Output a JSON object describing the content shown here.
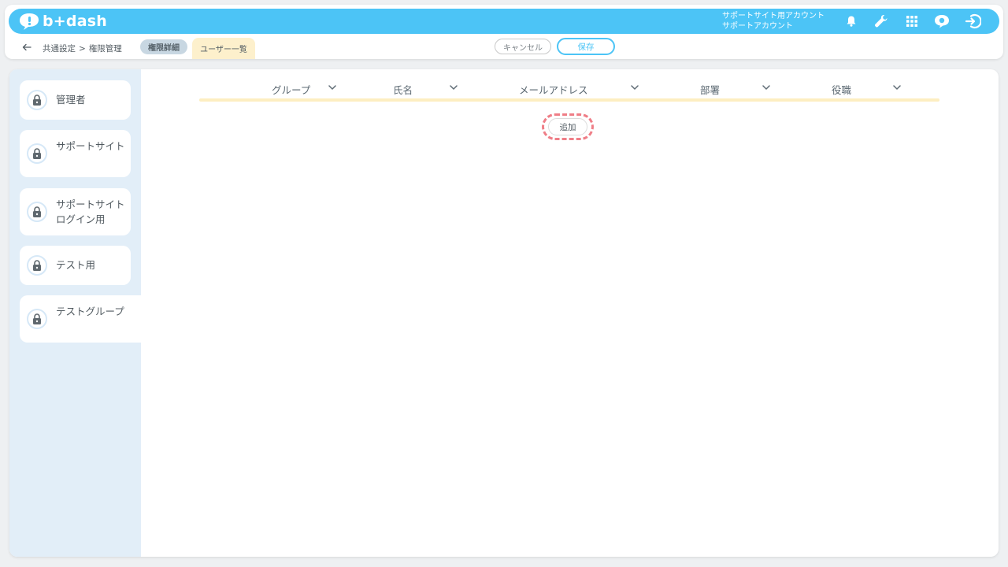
{
  "app": {
    "logo_text": "b+dash",
    "brand_color": "#4cc4f6"
  },
  "account": {
    "line1": "サポートサイト用アカウント",
    "line2": "サポートアカウント"
  },
  "header_icons": [
    "bell-icon",
    "wrench-icon",
    "grid-icon",
    "chat-badge-icon",
    "logout-icon"
  ],
  "breadcrumb": {
    "part1": "共通設定",
    "separator": ">",
    "part2": "権限管理"
  },
  "tabs": {
    "detail": "権限詳細",
    "users": "ユーザー一覧"
  },
  "actions": {
    "cancel": "キャンセル",
    "save": "保存"
  },
  "sidebar": {
    "items": [
      {
        "label": "管理者"
      },
      {
        "label": "サポートサイト"
      },
      {
        "label": "サポートサイトログイン用"
      },
      {
        "label": "テスト用"
      },
      {
        "label": "テストグループ"
      }
    ]
  },
  "table": {
    "columns": [
      "グループ",
      "氏名",
      "メールアドレス",
      "部署",
      "役職"
    ]
  },
  "add_button": "追加"
}
